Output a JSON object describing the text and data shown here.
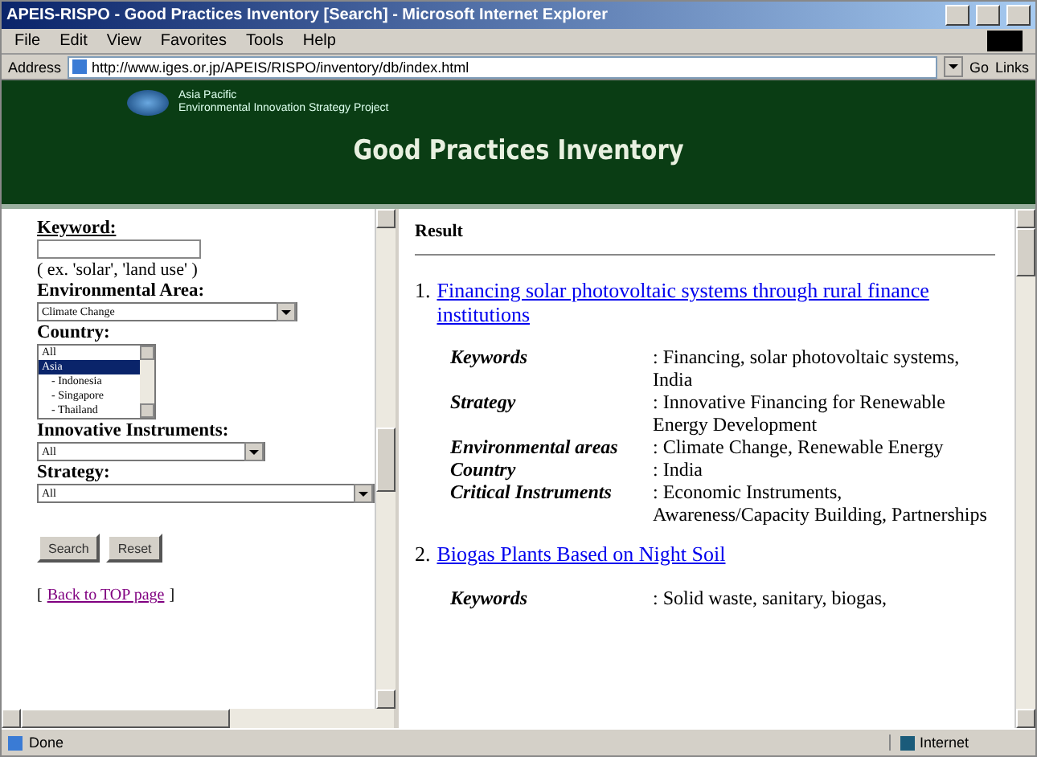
{
  "window": {
    "title": "APEIS-RISPO - Good Practices Inventory [Search] - Microsoft Internet Explorer"
  },
  "menu": [
    "File",
    "Edit",
    "View",
    "Favorites",
    "Tools",
    "Help"
  ],
  "address_bar": {
    "label": "Address",
    "url": "http://www.iges.or.jp/APEIS/RISPO/inventory/db/index.html",
    "go": "Go",
    "links": "Links"
  },
  "banner": {
    "logo_lines": [
      "Asia Pacific",
      "Environmental Innovation Strategy Project"
    ],
    "title": "Good Practices Inventory"
  },
  "search_form": {
    "keyword": {
      "label": "Keyword:",
      "hint": "( ex. 'solar', 'land use' )"
    },
    "environmental_area": {
      "label": "Environmental Area:",
      "value": "Climate Change"
    },
    "country": {
      "label": "Country:",
      "options": [
        {
          "label": "All",
          "selected": false,
          "indent": false
        },
        {
          "label": "Asia",
          "selected": true,
          "indent": false
        },
        {
          "label": "- Indonesia",
          "selected": false,
          "indent": true
        },
        {
          "label": "- Singapore",
          "selected": false,
          "indent": true
        },
        {
          "label": "- Thailand",
          "selected": false,
          "indent": true
        }
      ]
    },
    "innovative_instruments": {
      "label": "Innovative Instruments:",
      "value": "All"
    },
    "strategy": {
      "label": "Strategy:",
      "value": "All"
    },
    "buttons": [
      "Search",
      "Reset"
    ],
    "back_link": {
      "open": "[",
      "text": "Back to TOP page",
      "close": "]"
    }
  },
  "results": {
    "heading": "Result",
    "items": [
      {
        "number": "1.",
        "title": "Financing solar photovoltaic systems through rural finance institutions",
        "fields": [
          {
            "label": "Keywords",
            "value": ": Financing, solar photovoltaic systems, India"
          },
          {
            "label": "Strategy",
            "value": ": Innovative Financing for Renewable Energy Development"
          },
          {
            "label": "Environmental areas",
            "value": ": Climate Change, Renewable Energy"
          },
          {
            "label": "Country",
            "value": ": India"
          },
          {
            "label": "Critical Instruments",
            "value": ": Economic Instruments, Awareness/Capacity Building, Partnerships"
          }
        ]
      },
      {
        "number": "2.",
        "title": "Biogas Plants Based on Night Soil",
        "fields": [
          {
            "label": "Keywords",
            "value": ": Solid waste, sanitary, biogas,"
          }
        ]
      }
    ]
  },
  "status_bar": {
    "text": "Done",
    "zone": "Internet"
  }
}
